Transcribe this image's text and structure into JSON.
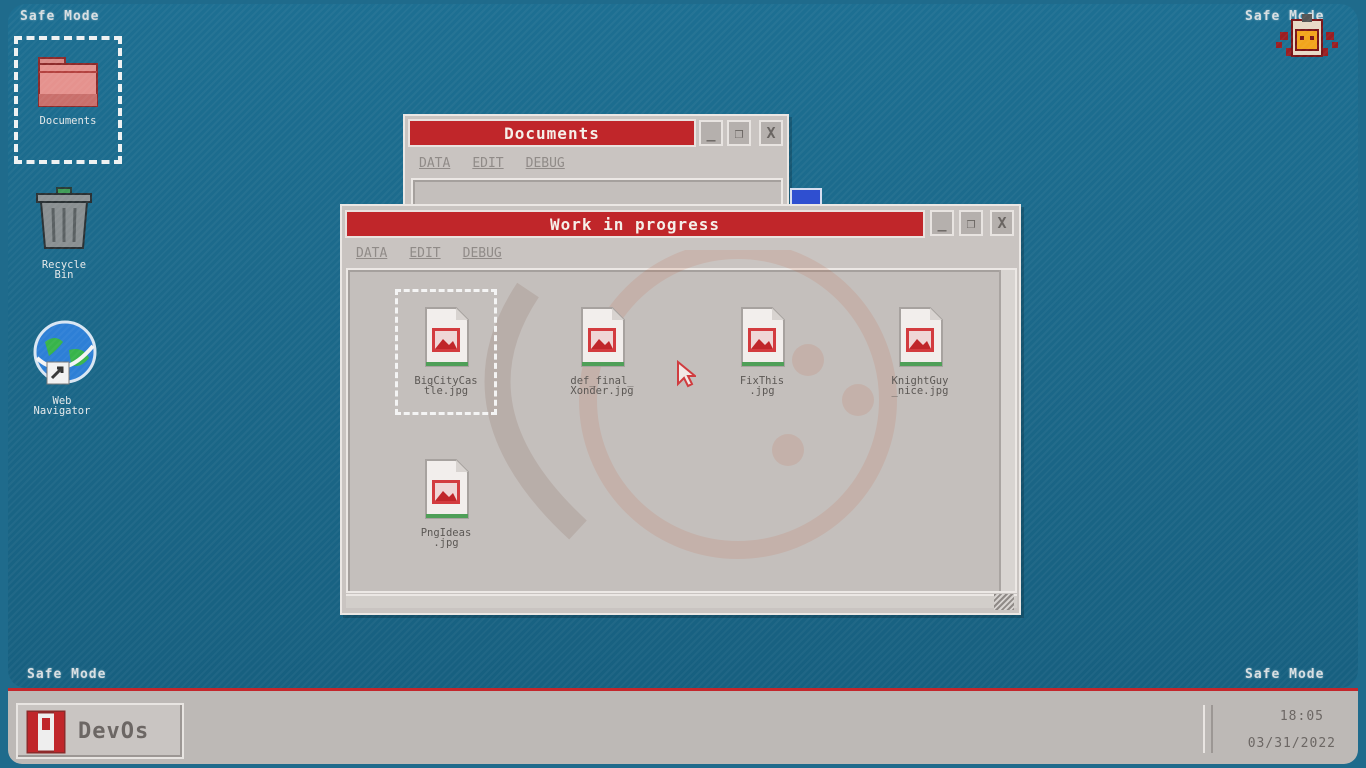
{
  "desktop": {
    "mode_label": "Safe Mode",
    "icons": [
      {
        "label": "Documents"
      },
      {
        "label": "Recycle\nBin"
      },
      {
        "label": "Web\nNavigator"
      }
    ]
  },
  "windows": {
    "documents": {
      "title": "Documents",
      "menu": [
        "DATA",
        "EDIT",
        "DEBUG"
      ]
    },
    "wip": {
      "title": "Work in progress",
      "menu": [
        "DATA",
        "EDIT",
        "DEBUG"
      ],
      "files": [
        {
          "name": "BigCityCas\ntle.jpg"
        },
        {
          "name": "def_final_\nXonder.jpg"
        },
        {
          "name": "FixThis\n.jpg"
        },
        {
          "name": "KnightGuy\n_nice.jpg"
        },
        {
          "name": "PngIdeas\n.jpg"
        }
      ]
    }
  },
  "window_buttons": {
    "minimize": "_",
    "maximize": "❐",
    "close": "X"
  },
  "taskbar": {
    "start_label": "DevOs",
    "time": "18:05",
    "date": "03/31/2022"
  },
  "colors": {
    "desktop": "#1d6f92",
    "titlebar": "#c0262a",
    "window": "#c9c4c1"
  }
}
